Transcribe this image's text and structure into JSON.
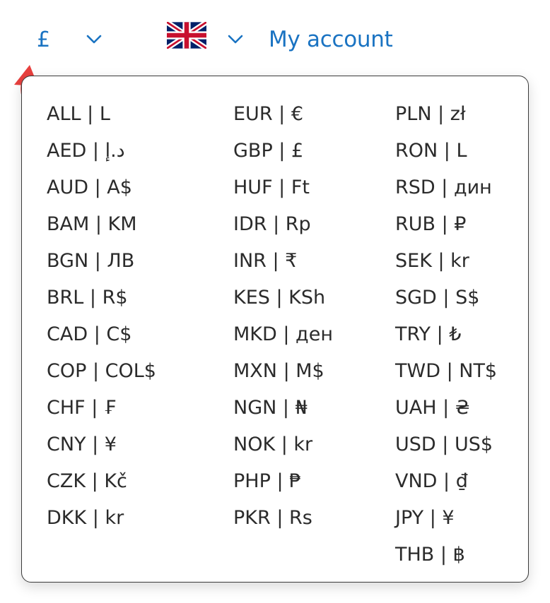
{
  "header": {
    "currency_symbol": "£",
    "account_label": "My account",
    "language_flag": "uk-flag-icon"
  },
  "currencies": {
    "col1": [
      "ALL | L",
      "AED | د.إ",
      "AUD | A$",
      "BAM | KM",
      "BGN | ЛВ",
      "BRL | R$",
      "CAD | C$",
      "COP | COL$",
      "CHF | ₣",
      "CNY | ¥",
      "CZK | Kč",
      "DKK | kr"
    ],
    "col2": [
      "EUR | €",
      "GBP | £",
      "HUF | Ft",
      "IDR | Rp",
      "INR | ₹",
      "KES | KSh",
      "MKD | ден",
      "MXN | M$",
      "NGN | ₦",
      "NOK | kr",
      "PHP | ₱",
      "PKR | Rs"
    ],
    "col3": [
      "PLN | zł",
      "RON | L",
      "RSD | дин",
      "RUB | ₽",
      "SEK | kr",
      "SGD | S$",
      "TRY | ₺",
      "TWD | NT$",
      "UAH | ₴",
      "USD | US$",
      "VND | ₫",
      "JPY | ¥",
      "THB | ฿"
    ]
  },
  "colors": {
    "link": "#1a73c2",
    "arrow": "#e8403e",
    "text": "#2b2b2b"
  }
}
